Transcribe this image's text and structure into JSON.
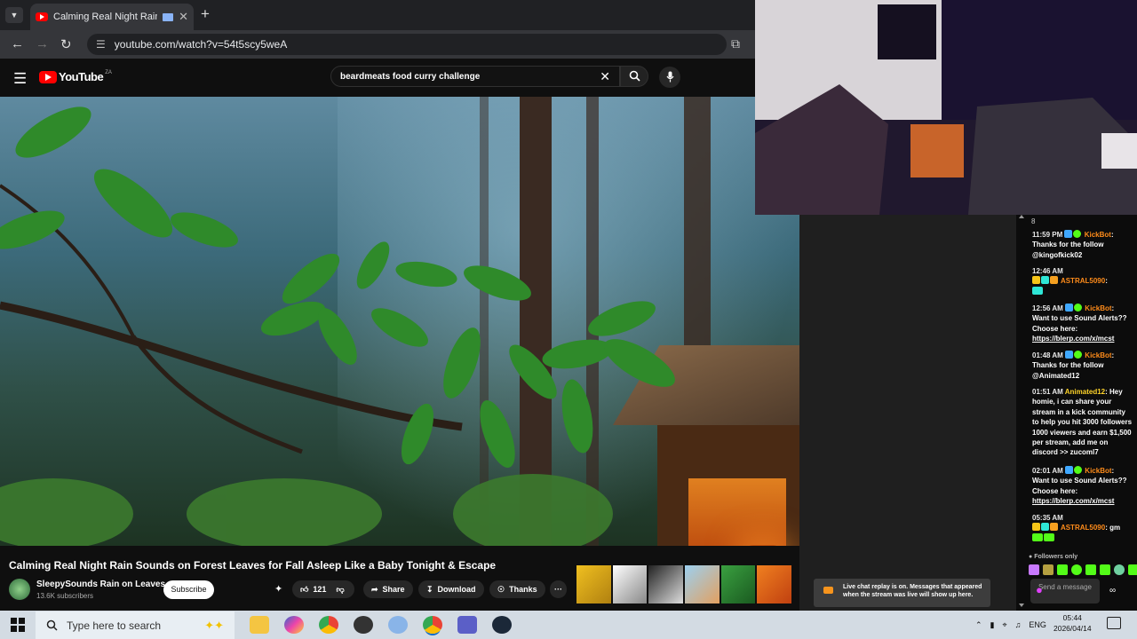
{
  "browser": {
    "tab_title": "Calming Real Night Rain Sc",
    "new_tab": "+",
    "url": "youtube.com/watch?v=54t5scy5weA"
  },
  "youtube": {
    "logo_text": "YouTube",
    "region": "ZA",
    "search_query": "beardmeats food curry challenge",
    "video_title": "Calming Real Night Rain Sounds on Forest Leaves for Fall Asleep Like a Baby Tonight & Escape",
    "channel_name": "SleepySounds Rain on Leaves",
    "subscribers": "13.6K subscribers",
    "subscribe_label": "Subscribe",
    "like_count": "121",
    "share_label": "Share",
    "download_label": "Download",
    "thanks_label": "Thanks",
    "more_label": "···"
  },
  "chat": {
    "top_counter": "8",
    "messages": [
      {
        "time": "11:59 PM",
        "user": "KickBot",
        "text": "Thanks for the follow @kingofkick02"
      },
      {
        "time": "12:46 AM",
        "user": "ASTRAL5090",
        "text": ""
      },
      {
        "time": "12:56 AM",
        "user": "KickBot",
        "text": "Want to use Sound Alerts?? Choose here:",
        "link": "https://blerp.com/x/mcst"
      },
      {
        "time": "01:48 AM",
        "user": "KickBot",
        "text": "Thanks for the follow @Animated12"
      },
      {
        "time": "01:51 AM",
        "user": "Animated12",
        "text": "Hey homie, i can share your stream in a kick community to help you hit 3000 followers 1000 viewers and earn $1,500 per stream, add me on discord >> zucoml7"
      },
      {
        "time": "02:01 AM",
        "user": "KickBot",
        "text": "Want to use Sound Alerts?? Choose here:",
        "link": "https://blerp.com/x/mcst"
      },
      {
        "time": "05:35 AM",
        "user": "ASTRAL5090",
        "text": "gm"
      }
    ],
    "followers_only": "Followers only",
    "send_placeholder": "Send a message",
    "replay_notice": "Live chat replay is on. Messages that appeared when the stream was live will show up here."
  },
  "taskbar": {
    "search_placeholder": "Type here to search",
    "language": "ENG",
    "time": "05:44",
    "date": "2026/04/14"
  },
  "colors": {
    "youtube_red": "#ff0000",
    "kick_orange": "#ff8c1a",
    "kick_green": "#53fc18"
  }
}
